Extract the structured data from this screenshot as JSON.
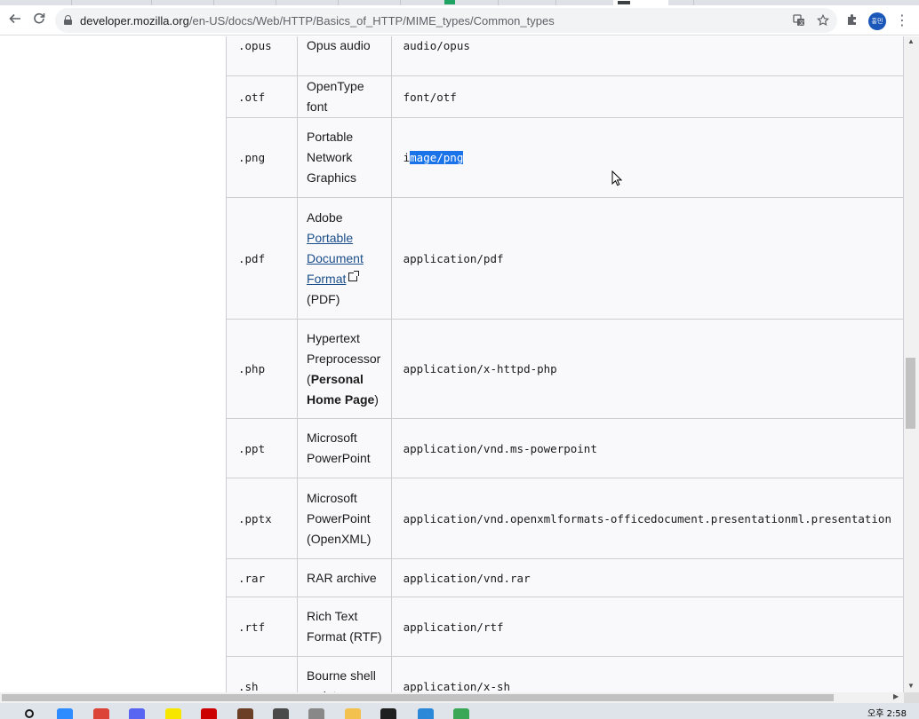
{
  "browser": {
    "url_host": "developer.mozilla.org",
    "url_path": "/en-US/docs/Web/HTTP/Basics_of_HTTP/MIME_types/Common_types",
    "profile_label": "홍민"
  },
  "icons": {
    "back": "arrow-back-icon",
    "reload": "reload-icon",
    "lock": "lock-icon",
    "translate": "translate-icon",
    "bookmark": "star-icon",
    "extensions": "puzzle-icon",
    "menu": "kebab-menu-icon",
    "external_link": "external-link-icon",
    "cursor": "mouse-cursor-icon"
  },
  "table": {
    "rows": [
      {
        "ext": ".opus",
        "kind": "Opus audio",
        "mime": "audio/opus"
      },
      {
        "ext": ".otf",
        "kind": "OpenType font",
        "mime": "font/otf"
      },
      {
        "ext": ".png",
        "kind": "Portable Network Graphics",
        "mime_pre": "i",
        "mime_sel": "mage/png"
      },
      {
        "ext": ".pdf",
        "kind_pre": "Adobe",
        "kind_link": "Portable Document Format",
        "kind_post": "(PDF)",
        "mime": "application/pdf"
      },
      {
        "ext": ".php",
        "kind_pre": "Hypertext Preprocessor (",
        "kind_bold": "Personal Home Page",
        "kind_post": ")",
        "mime": "application/x-httpd-php"
      },
      {
        "ext": ".ppt",
        "kind": "Microsoft PowerPoint",
        "mime": "application/vnd.ms-powerpoint"
      },
      {
        "ext": ".pptx",
        "kind": "Microsoft PowerPoint (OpenXML)",
        "mime": "application/vnd.openxmlformats-officedocument.presentationml.presentation"
      },
      {
        "ext": ".rar",
        "kind": "RAR archive",
        "mime": "application/vnd.rar"
      },
      {
        "ext": ".rtf",
        "kind": "Rich Text Format (RTF)",
        "mime": "application/rtf"
      },
      {
        "ext": ".sh",
        "kind": "Bourne shell script",
        "mime": "application/x-sh"
      }
    ]
  },
  "taskbar": {
    "clock": "오후 2:58",
    "icons": [
      "search-icon",
      "zoom-icon",
      "chrome-icon",
      "discord-icon",
      "kakaotalk-icon",
      "acrobat-icon",
      "app-icon",
      "app-icon",
      "app-icon",
      "file-explorer-icon",
      "terminal-icon",
      "photos-icon",
      "edge-icon"
    ],
    "colors": [
      "#1a1a1a",
      "#2d8cff",
      "#db4437",
      "#5865f2",
      "#f7e600",
      "#cc0000",
      "#6b3e26",
      "#4a4a4a",
      "#888888",
      "#f2c14e",
      "#1f1f1f",
      "#2b88d8",
      "#3aa757"
    ]
  }
}
